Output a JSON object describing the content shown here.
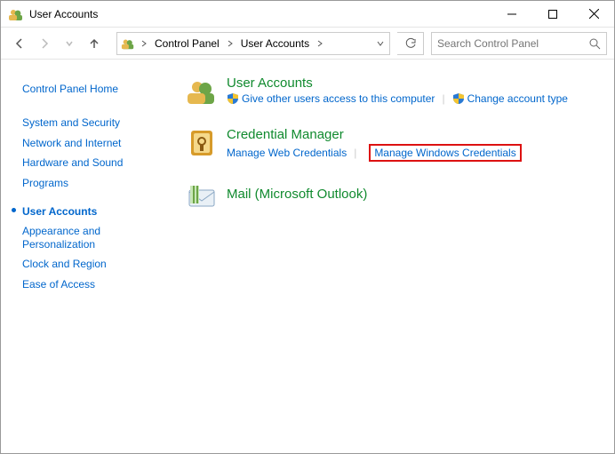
{
  "title": "User Accounts",
  "breadcrumbs": {
    "root": "Control Panel",
    "current": "User Accounts"
  },
  "search": {
    "placeholder": "Search Control Panel"
  },
  "sidebar": {
    "home": "Control Panel Home",
    "items": [
      "System and Security",
      "Network and Internet",
      "Hardware and Sound",
      "Programs",
      "User Accounts",
      "Appearance and Personalization",
      "Clock and Region",
      "Ease of Access"
    ]
  },
  "categories": {
    "user_accounts": {
      "title": "User Accounts",
      "give_access": "Give other users access to this computer",
      "change_type": "Change account type"
    },
    "credential_manager": {
      "title": "Credential Manager",
      "manage_web": "Manage Web Credentials",
      "manage_win": "Manage Windows Credentials"
    },
    "mail": {
      "title": "Mail (Microsoft Outlook)"
    }
  }
}
